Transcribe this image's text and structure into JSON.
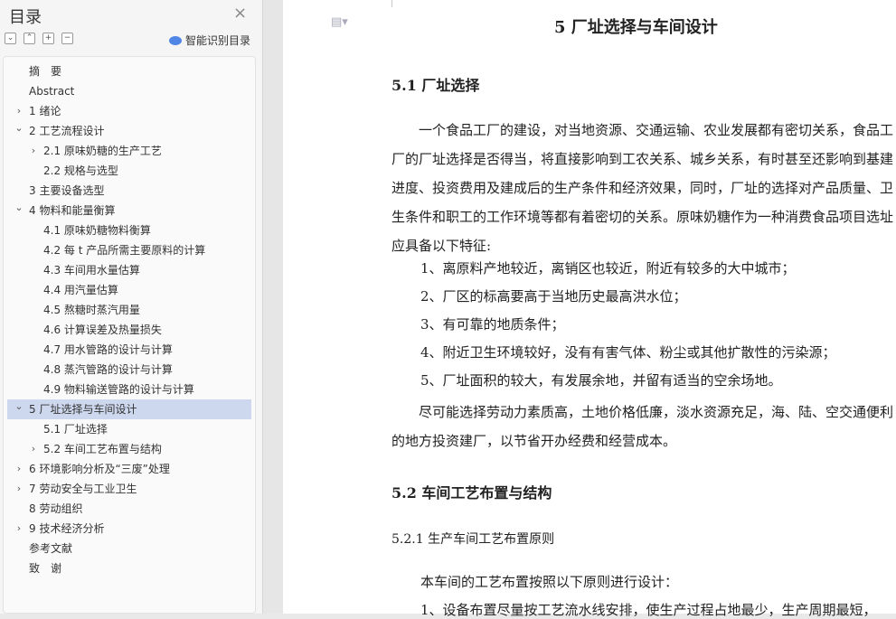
{
  "sidebar": {
    "title": "目录",
    "smart_label": "智能识别目录",
    "items": [
      {
        "label": "摘　要",
        "level": 0,
        "chevron": ""
      },
      {
        "label": "Abstract",
        "level": 0,
        "chevron": ""
      },
      {
        "label": "1 绪论",
        "level": 0,
        "chevron": "right"
      },
      {
        "label": "2 工艺流程设计",
        "level": 0,
        "chevron": "down"
      },
      {
        "label": "2.1  原味奶糖的生产工艺",
        "level": 1,
        "chevron": "right"
      },
      {
        "label": "2.2 规格与选型",
        "level": 1,
        "chevron": ""
      },
      {
        "label": "3 主要设备选型",
        "level": 0,
        "chevron": ""
      },
      {
        "label": "4 物料和能量衡算",
        "level": 0,
        "chevron": "down"
      },
      {
        "label": "4.1  原味奶糖物料衡算",
        "level": 1,
        "chevron": ""
      },
      {
        "label": "4.2  每 t 产品所需主要原料的计算",
        "level": 1,
        "chevron": ""
      },
      {
        "label": "4.3  车间用水量估算",
        "level": 1,
        "chevron": ""
      },
      {
        "label": "4.4 用汽量估算",
        "level": 1,
        "chevron": ""
      },
      {
        "label": "4.5 熬糖时蒸汽用量",
        "level": 1,
        "chevron": ""
      },
      {
        "label": "4.6 计算误差及热量损失",
        "level": 1,
        "chevron": ""
      },
      {
        "label": "4.7 用水管路的设计与计算",
        "level": 1,
        "chevron": ""
      },
      {
        "label": "4.8 蒸汽管路的设计与计算",
        "level": 1,
        "chevron": ""
      },
      {
        "label": "4.9 物料输送管路的设计与计算",
        "level": 1,
        "chevron": ""
      },
      {
        "label": "5 厂址选择与车间设计",
        "level": 0,
        "chevron": "down",
        "active": true
      },
      {
        "label": "5.1 厂址选择",
        "level": 1,
        "chevron": ""
      },
      {
        "label": "5.2 车间工艺布置与结构",
        "level": 1,
        "chevron": "right"
      },
      {
        "label": "6 环境影响分析及“三废”处理",
        "level": 0,
        "chevron": "right"
      },
      {
        "label": "7 劳动安全与工业卫生",
        "level": 0,
        "chevron": "right"
      },
      {
        "label": "8 劳动组织",
        "level": 0,
        "chevron": ""
      },
      {
        "label": "9 技术经济分析",
        "level": 0,
        "chevron": "right"
      },
      {
        "label": "参考文献",
        "level": 0,
        "chevron": ""
      },
      {
        "label": "致　谢",
        "level": 0,
        "chevron": ""
      }
    ]
  },
  "document": {
    "chapter_title": "5 厂址选择与车间设计",
    "section1_title": "5.1 厂址选择",
    "intro_para": "　　一个食品工厂的建设，对当地资源、交通运输、农业发展都有密切关系，食品工厂的厂址选择是否得当，将直接影响到工农关系、城乡关系，有时甚至还影响到基建进度、投资费用及建成后的生产条件和经济效果，同时，厂址的选择对产品质量、卫生条件和职工的工作环境等都有着密切的关系。原味奶糖作为一种消费食品项目选址应具备以下特征:",
    "list": [
      "1、离原料产地较近，离销区也较近，附近有较多的大中城市；",
      "2、厂区的标高要高于当地历史最高洪水位；",
      "3、有可靠的地质条件；",
      "4、附近卫生环境较好，没有有害气体、粉尘或其他扩散性的污染源；",
      "5、厂址面积的较大，有发展余地，并留有适当的空余场地。"
    ],
    "closing_para": "　　尽可能选择劳动力素质高，土地价格低廉，淡水资源充足，海、陆、空交通便利的地方投资建厂，以节省开办经费和经营成本。",
    "section2_title": "5.2 车间工艺布置与结构",
    "subsection_title": "5.2.1 生产车间工艺布置原则",
    "sub_intro": "本车间的工艺布置按照以下原则进行设计：",
    "sub_item1": "1、设备布置尽量按工艺流水线安排，使生产过程占地最少，生产周期最短，"
  }
}
